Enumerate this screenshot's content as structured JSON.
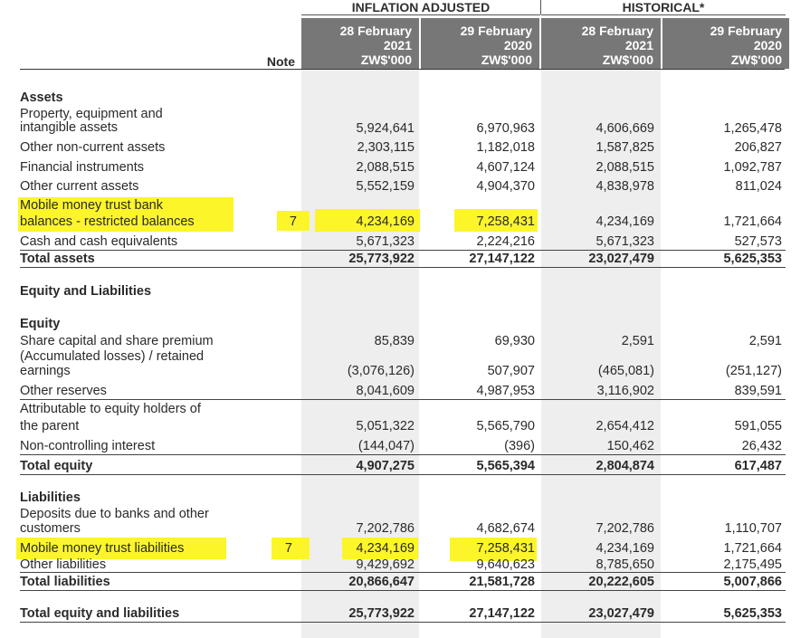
{
  "header": {
    "group_inflation": "INFLATION ADJUSTED",
    "group_historical": "HISTORICAL*",
    "note_label": "Note",
    "columns": [
      {
        "date": "28 February",
        "year": "2021",
        "unit": "ZW$'000"
      },
      {
        "date": "29 February",
        "year": "2020",
        "unit": "ZW$'000"
      },
      {
        "date": "28 February",
        "year": "2021",
        "unit": "ZW$'000"
      },
      {
        "date": "29 February",
        "year": "2020",
        "unit": "ZW$'000"
      }
    ]
  },
  "assets": {
    "title": "Assets",
    "ppe": {
      "l1": "Property, equipment and",
      "l2": "intangible assets",
      "v": [
        "5,924,641",
        "6,970,963",
        "4,606,669",
        "1,265,478"
      ]
    },
    "oncur": {
      "l": "Other non-current assets",
      "v": [
        "2,303,115",
        "1,182,018",
        "1,587,825",
        "206,827"
      ]
    },
    "fin": {
      "l": "Financial instruments",
      "v": [
        "2,088,515",
        "4,607,124",
        "2,088,515",
        "1,092,787"
      ]
    },
    "ocur": {
      "l": "Other current assets",
      "v": [
        "5,552,159",
        "4,904,370",
        "4,838,978",
        "811,024"
      ]
    },
    "mm": {
      "l1": "Mobile money trust bank",
      "l2": "balances - restricted balances",
      "note": "7",
      "v": [
        "4,234,169",
        "7,258,431",
        "4,234,169",
        "1,721,664"
      ]
    },
    "cash": {
      "l": "Cash and cash equivalents",
      "v": [
        "5,671,323",
        "2,224,216",
        "5,671,323",
        "527,573"
      ]
    },
    "total": {
      "l": "Total assets",
      "v": [
        "25,773,922",
        "27,147,122",
        "23,027,479",
        "5,625,353"
      ]
    }
  },
  "eq_liab_title": "Equity and Liabilities",
  "equity": {
    "title": "Equity",
    "share": {
      "l": "Share capital and share premium",
      "v": [
        "85,839",
        "69,930",
        "2,591",
        "2,591"
      ]
    },
    "accum": {
      "l1": "(Accumulated losses) / retained",
      "l2": "earnings",
      "v": [
        "(3,076,126)",
        "507,907",
        "(465,081)",
        "(251,127)"
      ]
    },
    "reserves": {
      "l": "Other reserves",
      "v": [
        "8,041,609",
        "4,987,953",
        "3,116,902",
        "839,591"
      ]
    },
    "attrib": {
      "l1": "Attributable to equity holders of",
      "l2": "the parent",
      "v": [
        "5,051,322",
        "5,565,790",
        "2,654,412",
        "591,055"
      ]
    },
    "nci": {
      "l": "Non-controlling interest",
      "v": [
        "(144,047)",
        "(396)",
        "150,462",
        "26,432"
      ]
    },
    "total": {
      "l": "Total equity",
      "v": [
        "4,907,275",
        "5,565,394",
        "2,804,874",
        "617,487"
      ]
    }
  },
  "liabilities": {
    "title": "Liabilities",
    "deposits": {
      "l1": "Deposits due to banks and other",
      "l2": "customers",
      "v": [
        "7,202,786",
        "4,682,674",
        "7,202,786",
        "1,110,707"
      ]
    },
    "mm": {
      "l": "Mobile money trust liabilities",
      "note": "7",
      "v": [
        "4,234,169",
        "7,258,431",
        "4,234,169",
        "1,721,664"
      ]
    },
    "other": {
      "l": "Other liabilities",
      "v": [
        "9,429,692",
        "9,640,623",
        "8,785,650",
        "2,175,495"
      ]
    },
    "total": {
      "l": "Total liabilities",
      "v": [
        "20,866,647",
        "21,581,728",
        "20,222,605",
        "5,007,866"
      ]
    }
  },
  "grand_total": {
    "l": "Total equity and liabilities",
    "v": [
      "25,773,922",
      "27,147,122",
      "23,027,479",
      "5,625,353"
    ]
  },
  "colors": {
    "highlight": "#fbf52a",
    "header_bg": "#777777",
    "shade": "#eeeeee"
  }
}
